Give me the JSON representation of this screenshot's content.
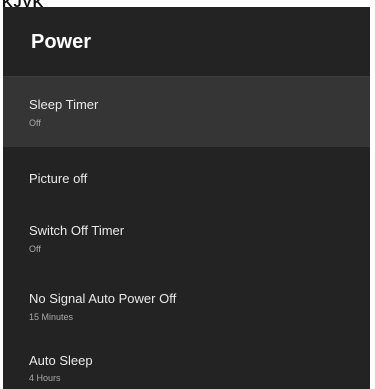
{
  "top_fragment": "KJVK",
  "panel": {
    "title": "Power",
    "items": [
      {
        "label": "Sleep Timer",
        "value": "Off",
        "selected": true
      },
      {
        "label": "Picture off",
        "value": "",
        "selected": false
      },
      {
        "label": "Switch Off Timer",
        "value": "Off",
        "selected": false
      },
      {
        "label": "No Signal Auto Power Off",
        "value": "15 Minutes",
        "selected": false
      },
      {
        "label": "Auto Sleep",
        "value": "4 Hours",
        "selected": false
      }
    ]
  },
  "colors": {
    "panel_background": "#232323",
    "selected_row": "#353535",
    "label_text": "#e9e9e9",
    "value_text": "#a9a9a9"
  }
}
